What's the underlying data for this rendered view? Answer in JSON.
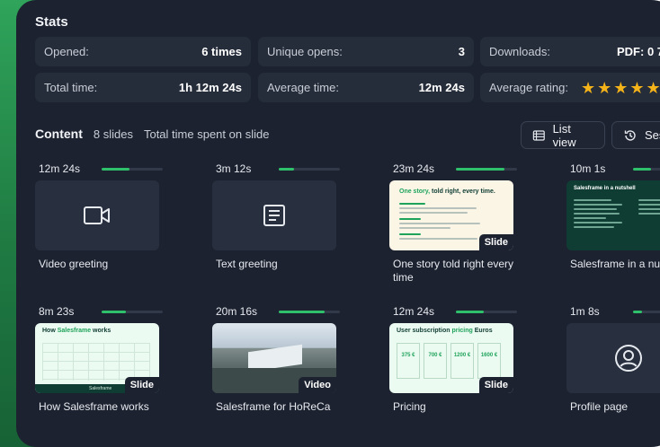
{
  "stats": {
    "title": "Stats",
    "opened_label": "Opened:",
    "opened_value": "6 times",
    "unique_label": "Unique opens:",
    "unique_value": "3",
    "downloads_label": "Downloads:",
    "downloads_value": "PDF: 0  7",
    "total_time_label": "Total time:",
    "total_time_value": "1h 12m 24s",
    "avg_time_label": "Average time:",
    "avg_time_value": "12m 24s",
    "avg_rating_label": "Average rating:",
    "avg_rating_stars": 5
  },
  "content": {
    "title": "Content",
    "slides_count": "8 slides",
    "subtitle": "Total time spent on slide",
    "list_view_label": "List view",
    "sessions_label": "Ses"
  },
  "cards": [
    {
      "time": "12m 24s",
      "progress": 0.45,
      "title": "Video greeting",
      "kind": "video-icon",
      "badge": ""
    },
    {
      "time": "3m 12s",
      "progress": 0.25,
      "title": "Text greeting",
      "kind": "text-icon",
      "badge": ""
    },
    {
      "time": "23m 24s",
      "progress": 0.8,
      "title": "One story told right every time",
      "kind": "slide-story",
      "badge": "Slide"
    },
    {
      "time": "10m 1s",
      "progress": 0.3,
      "title": "Salesframe in a nuts",
      "kind": "slide-nutshell",
      "badge": ""
    },
    {
      "time": "8m 23s",
      "progress": 0.4,
      "title": "How Salesframe works",
      "kind": "slide-works",
      "badge": "Slide"
    },
    {
      "time": "20m 16s",
      "progress": 0.75,
      "title": "Salesframe for HoReCa",
      "kind": "photo",
      "badge": "Video"
    },
    {
      "time": "12m 24s",
      "progress": 0.45,
      "title": "Pricing",
      "kind": "slide-pricing",
      "badge": "Slide"
    },
    {
      "time": "1m 8s",
      "progress": 0.15,
      "title": "Profile page",
      "kind": "profile-icon",
      "badge": ""
    }
  ],
  "slide_text": {
    "story_heading_1": "One story,",
    "story_heading_2": " told right, every time.",
    "nutshell_heading": "Salesframe in a nutshell",
    "works_heading_1": "How ",
    "works_heading_2": "Salesframe",
    "works_heading_3": " works",
    "pricing_heading_1": "User subscription ",
    "pricing_heading_2": "pricing",
    "pricing_heading_3": " Euros",
    "pricing_values": [
      "375 €",
      "700 €",
      "1200 €",
      "1600 €"
    ],
    "brand": "Salesframe"
  },
  "colors": {
    "accent": "#2ec06a",
    "star": "#f5b31a",
    "panel": "#1c2230",
    "tile": "#252c3a"
  }
}
